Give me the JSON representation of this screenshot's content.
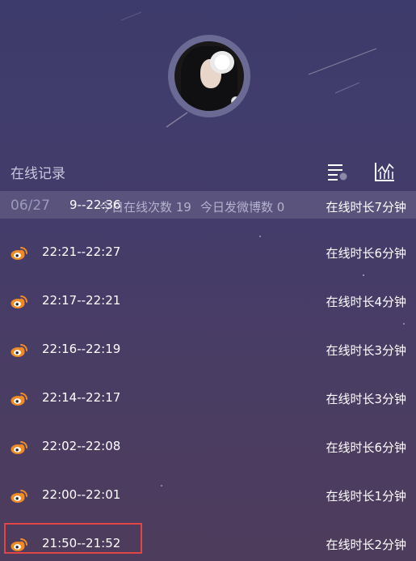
{
  "header": {
    "section_title": "在线记录"
  },
  "icons": {
    "filter": "filter-icon",
    "chart": "chart-icon",
    "weibo": "weibo-icon"
  },
  "summary": {
    "date": "06/27",
    "overlay_time": "9--22:36",
    "online_count_label": "今日在线次数 19",
    "weibo_count_label": "今日发微博数 0",
    "duration": "在线时长7分钟"
  },
  "records": [
    {
      "time": "22:21--22:27",
      "duration": "在线时长6分钟"
    },
    {
      "time": "22:17--22:21",
      "duration": "在线时长4分钟"
    },
    {
      "time": "22:16--22:19",
      "duration": "在线时长3分钟"
    },
    {
      "time": "22:14--22:17",
      "duration": "在线时长3分钟"
    },
    {
      "time": "22:02--22:08",
      "duration": "在线时长6分钟"
    },
    {
      "time": "22:00--22:01",
      "duration": "在线时长1分钟"
    },
    {
      "time": "21:50--21:52",
      "duration": "在线时长2分钟"
    }
  ],
  "colors": {
    "weibo_orange": "#f08a24",
    "highlight": "#e24545"
  }
}
